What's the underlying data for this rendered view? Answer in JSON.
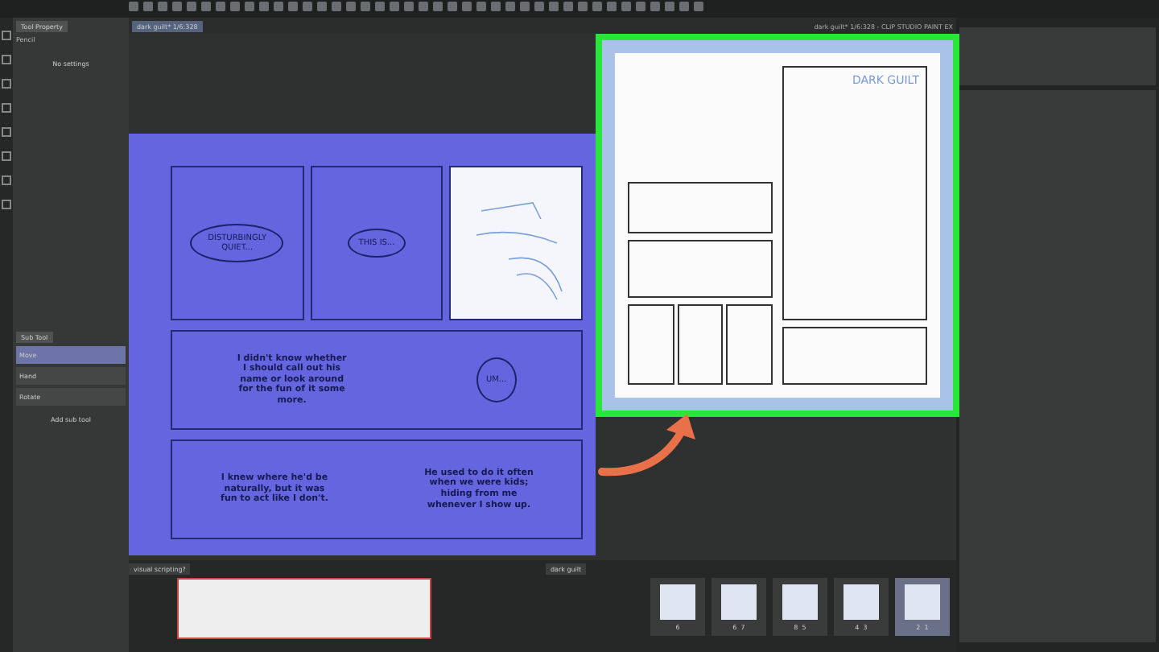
{
  "app": {
    "title": "dark guilt* 1/6:328 - CLIP STUDIO PAINT EX"
  },
  "tool_property": {
    "title": "Tool Property",
    "tool": "Pencil",
    "message": "No settings"
  },
  "sub_tool": {
    "title": "Sub Tool",
    "items": [
      {
        "label": "Move",
        "selected": true
      },
      {
        "label": "Hand",
        "selected": false
      },
      {
        "label": "Rotate",
        "selected": false
      }
    ],
    "add_label": "Add sub tool"
  },
  "canvas_tab": {
    "label": "dark guilt* 1/6:328"
  },
  "page": {
    "top_panels": [
      {
        "kind": "bubble",
        "text": "DISTURBINGLY QUIET..."
      },
      {
        "kind": "bubble",
        "text": "THIS IS..."
      },
      {
        "kind": "sketch"
      }
    ],
    "rows": [
      {
        "caption": "I didn't know whether I should call out his name or look around for the fun of it some more.",
        "side": {
          "kind": "bubble",
          "text": "UM..."
        }
      },
      {
        "caption": "I knew where he'd be naturally, but it was fun to act like I don't.",
        "side": {
          "kind": "caption",
          "text": "He used to do it often when we were kids; hiding from me whenever I show up."
        }
      }
    ]
  },
  "inset": {
    "title": "DARK GUILT"
  },
  "bottom": {
    "story_tab": "visual scripting?",
    "pages_tab": "dark guilt",
    "pages": [
      {
        "label": "6",
        "selected": false
      },
      {
        "label": "6  7",
        "selected": false
      },
      {
        "label": "8  5",
        "selected": false
      },
      {
        "label": "4  3",
        "selected": false
      },
      {
        "label": "2  1",
        "selected": true
      }
    ]
  }
}
